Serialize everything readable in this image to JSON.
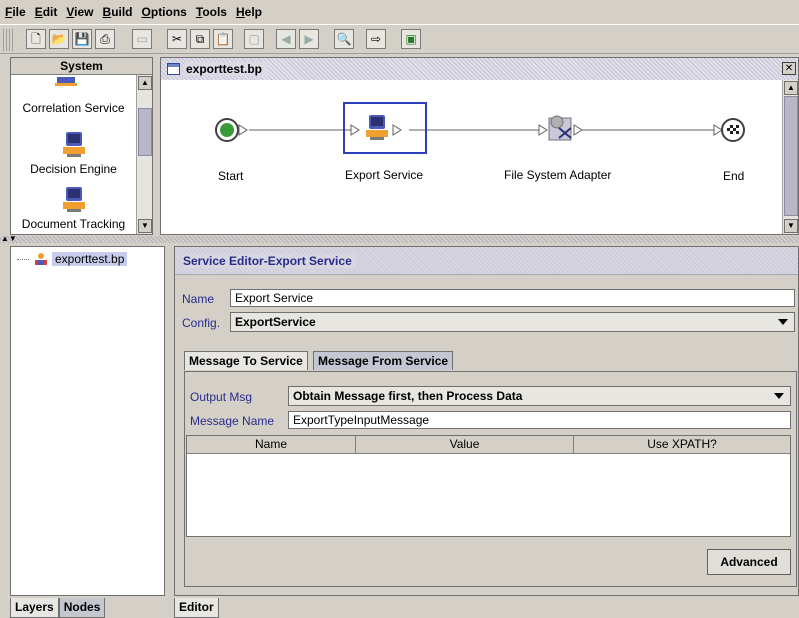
{
  "menu": [
    "File",
    "Edit",
    "View",
    "Build",
    "Options",
    "Tools",
    "Help"
  ],
  "palette": {
    "title": "System",
    "items": [
      "Correlation Service",
      "Decision Engine",
      "Document Tracking"
    ]
  },
  "diagram": {
    "title": "exporttest.bp",
    "nodes": [
      {
        "label": "Start",
        "icon": "start-running-icon"
      },
      {
        "label": "Export Service",
        "icon": "computer-service-icon",
        "selected": true
      },
      {
        "label": "File System Adapter",
        "icon": "adapter-gear-icon"
      },
      {
        "label": "End",
        "icon": "end-flag-icon"
      }
    ]
  },
  "tree": {
    "item": "exporttest.bp"
  },
  "left_tabs": [
    "Layers",
    "Nodes"
  ],
  "editor": {
    "title": "Service Editor-Export Service",
    "name_label": "Name",
    "name_value": "Export Service",
    "config_label": "Config.",
    "config_value": "ExportService",
    "tabs": [
      "Message To Service",
      "Message From Service"
    ],
    "output_msg_label": "Output Msg",
    "output_msg_value": "Obtain Message first, then Process Data",
    "message_name_label": "Message Name",
    "message_name_value": "ExportTypeInputMessage",
    "table_columns": [
      "Name",
      "Value",
      "Use XPATH?"
    ],
    "advanced_button": "Advanced",
    "bottom_tab": "Editor"
  },
  "colors": {
    "accent_text": "#2a2c8c",
    "selection": "#2d3fbf",
    "panel_bg": "#d4d0c8"
  }
}
